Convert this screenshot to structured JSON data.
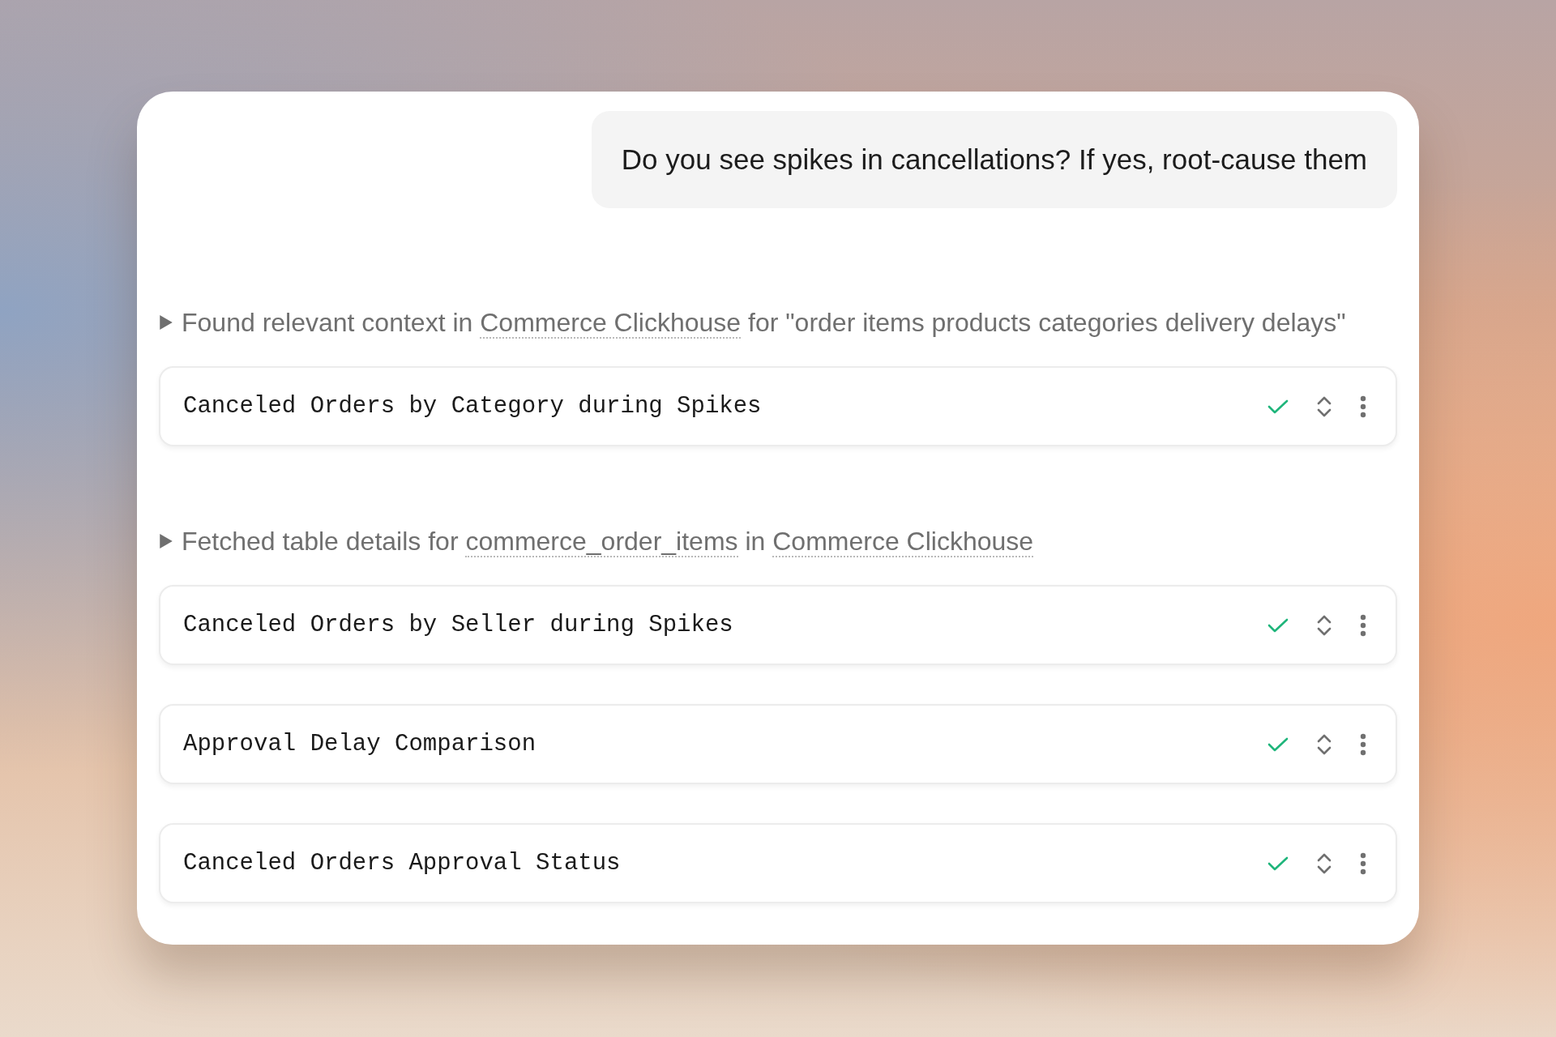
{
  "user_message": "Do you see spikes in cancellations? If yes, root-cause them",
  "steps": [
    {
      "kind": "context",
      "parts": [
        {
          "text": "Found relevant context in "
        },
        {
          "link": "Commerce Clickhouse"
        },
        {
          "text": " for \"order items products categories delivery delays\""
        }
      ]
    },
    {
      "kind": "query",
      "title": "Canceled Orders by Category during Spikes",
      "done": true
    },
    {
      "kind": "context",
      "parts": [
        {
          "text": "Fetched table details for "
        },
        {
          "link": "commerce_order_items"
        },
        {
          "text": " in "
        },
        {
          "link": "Commerce Clickhouse"
        }
      ]
    },
    {
      "kind": "query",
      "title": "Canceled Orders by Seller during Spikes",
      "done": true
    },
    {
      "kind": "query",
      "title": "Approval Delay Comparison",
      "done": true
    },
    {
      "kind": "query",
      "title": "Canceled Orders Approval Status",
      "done": true
    }
  ]
}
